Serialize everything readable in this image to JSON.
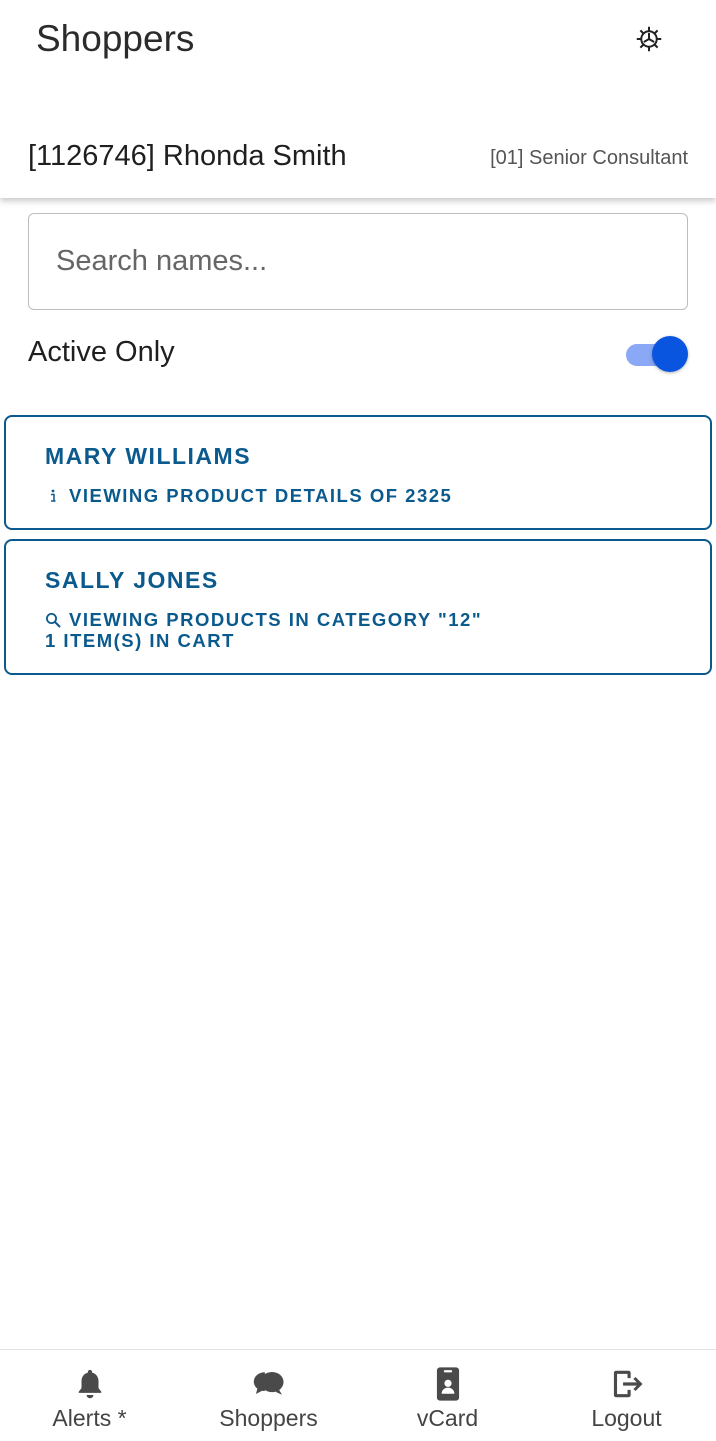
{
  "header": {
    "title": "Shoppers",
    "settings_icon": "gear-icon",
    "user_name": "[1126746] Rhonda Smith",
    "user_role": "[01] Senior Consultant"
  },
  "search": {
    "placeholder": "Search names...",
    "value": ""
  },
  "filter": {
    "label": "Active Only",
    "enabled": true
  },
  "shoppers": [
    {
      "name": "MARY WILLIAMS",
      "activity_icon": "info-icon",
      "activity": "VIEWING PRODUCT DETAILS OF 2325",
      "cart": ""
    },
    {
      "name": "SALLY JONES",
      "activity_icon": "search-icon",
      "activity": "VIEWING PRODUCTS IN CATEGORY \"12\"",
      "cart": "1 ITEM(S) IN CART"
    }
  ],
  "nav": [
    {
      "label": "Alerts *",
      "icon": "bell-icon"
    },
    {
      "label": "Shoppers",
      "icon": "chat-bubbles-icon"
    },
    {
      "label": "vCard",
      "icon": "contact-card-icon"
    },
    {
      "label": "Logout",
      "icon": "logout-icon"
    }
  ],
  "colors": {
    "accent": "#0b5a8e",
    "toggle_thumb": "#0a55e0",
    "toggle_track": "#8aa8f5",
    "nav_icon": "#4a4a4a"
  }
}
